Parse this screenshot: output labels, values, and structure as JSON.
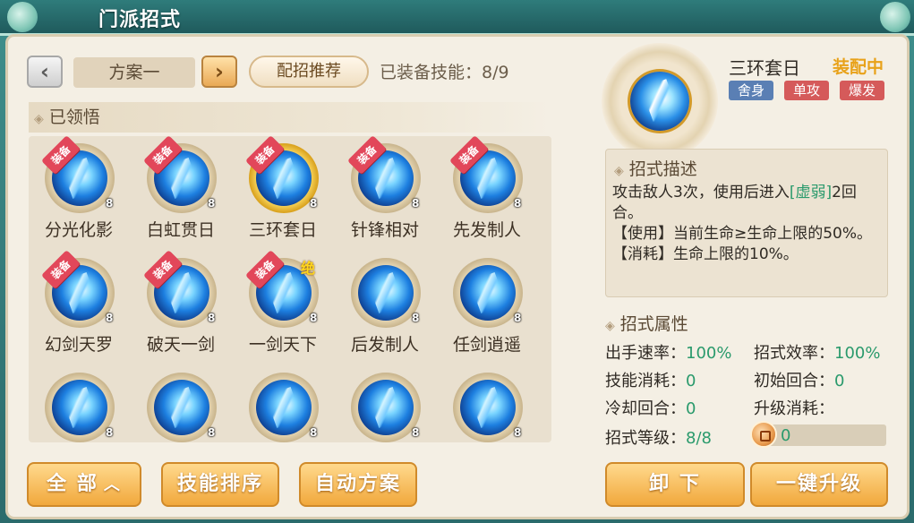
{
  "window": {
    "title": "门派招式"
  },
  "toolbar": {
    "prev_icon": "chevron-left-icon",
    "next_icon": "chevron-right-icon",
    "plan_label": "方案一",
    "recommend_label": "配招推荐",
    "equipped_label": "已装备技能：8/9"
  },
  "section": {
    "learned_label": "已领悟"
  },
  "skills": [
    {
      "name": "分光化影",
      "level": "8",
      "tag": "装备",
      "jue": "",
      "highlight": false
    },
    {
      "name": "白虹贯日",
      "level": "8",
      "tag": "装备",
      "jue": "",
      "highlight": false
    },
    {
      "name": "三环套日",
      "level": "8",
      "tag": "装备",
      "jue": "",
      "highlight": true
    },
    {
      "name": "针锋相对",
      "level": "8",
      "tag": "装备",
      "jue": "",
      "highlight": false
    },
    {
      "name": "先发制人",
      "level": "8",
      "tag": "装备",
      "jue": "",
      "highlight": false
    },
    {
      "name": "幻剑天罗",
      "level": "8",
      "tag": "装备",
      "jue": "",
      "highlight": false
    },
    {
      "name": "破天一剑",
      "level": "8",
      "tag": "装备",
      "jue": "",
      "highlight": false
    },
    {
      "name": "一剑天下",
      "level": "8",
      "tag": "装备",
      "jue": "绝",
      "highlight": false
    },
    {
      "name": "后发制人",
      "level": "8",
      "tag": "",
      "jue": "",
      "highlight": false
    },
    {
      "name": "任剑逍遥",
      "level": "8",
      "tag": "",
      "jue": "",
      "highlight": false
    },
    {
      "name": "",
      "level": "8",
      "tag": "",
      "jue": "",
      "highlight": false
    },
    {
      "name": "",
      "level": "8",
      "tag": "",
      "jue": "",
      "highlight": false
    },
    {
      "name": "",
      "level": "8",
      "tag": "",
      "jue": "",
      "highlight": false
    },
    {
      "name": "",
      "level": "8",
      "tag": "",
      "jue": "",
      "highlight": false
    },
    {
      "name": "",
      "level": "8",
      "tag": "",
      "jue": "",
      "highlight": false
    }
  ],
  "bottom_left": {
    "all_label": "全 部",
    "sort_label": "技能排序",
    "auto_label": "自动方案"
  },
  "detail": {
    "name": "三环套日",
    "equipped_text": "装配中",
    "chips": [
      "舍身",
      "单攻",
      "爆发"
    ],
    "desc_head": "招式描述",
    "desc_line1_pre": "攻击敌人3次，使用后进入",
    "desc_line1_hl": "[虚弱]",
    "desc_line1_post": "2回合。",
    "desc_line2": "【使用】当前生命≥生命上限的50%。",
    "desc_line3": "【消耗】生命上限的10%。",
    "attr_head": "招式属性",
    "attrs": {
      "speed_label": "出手速率：",
      "speed_value": "100%",
      "efficiency_label": "招式效率：",
      "efficiency_value": "100%",
      "cost_label": "技能消耗：",
      "cost_value": "0",
      "initial_label": "初始回合：",
      "initial_value": "0",
      "cooldown_label": "冷却回合：",
      "cooldown_value": "0",
      "upgrade_cost_label": "升级消耗：",
      "level_label": "招式等级：",
      "level_value": "8/8"
    },
    "upgrade_progress": "0"
  },
  "bottom_right": {
    "unequip_label": "卸 下",
    "upgrade_label": "一键升级"
  },
  "colors": {
    "accent_orange": "#f1a83c",
    "value_green": "#2a9a6c",
    "tag_red": "#e2475a",
    "gold": "#e8a21a"
  }
}
